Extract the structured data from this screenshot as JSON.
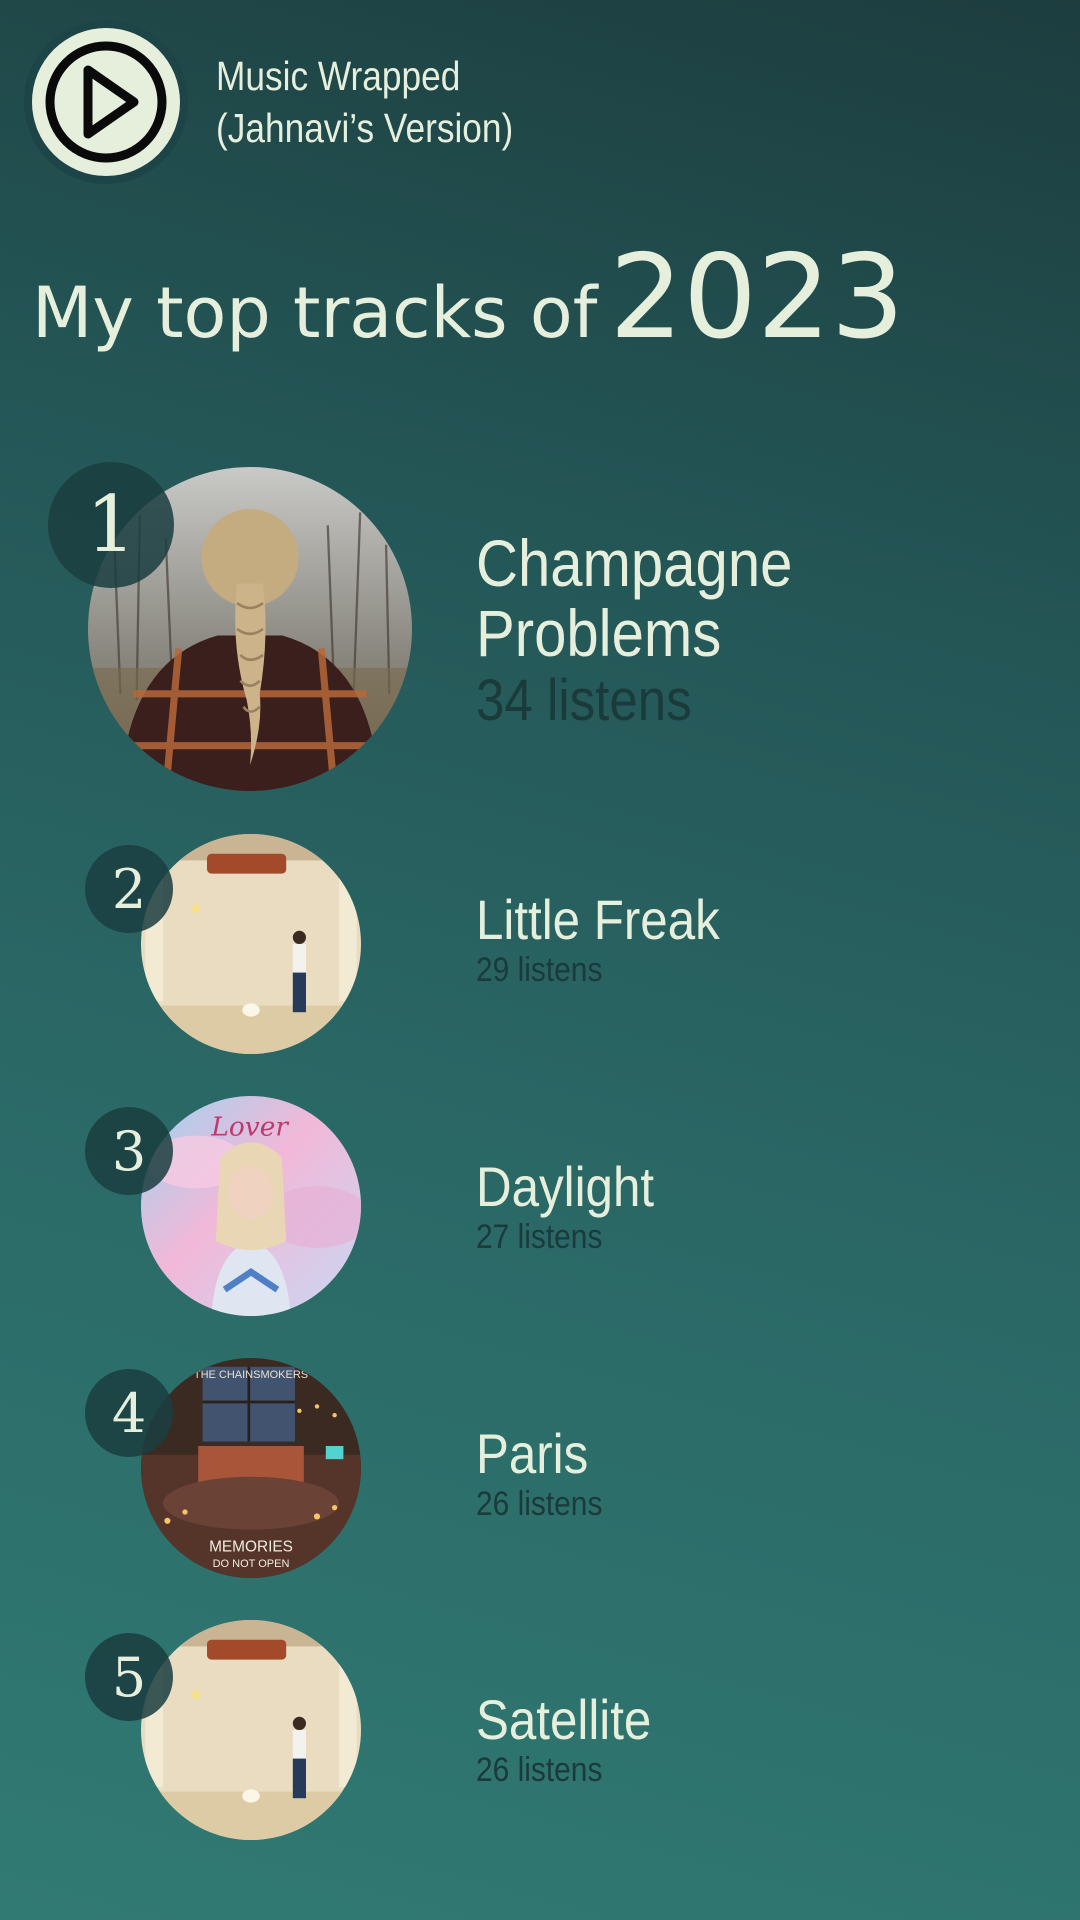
{
  "app": {
    "title_line1": "Music Wrapped",
    "title_line2": "(Jahnavi’s Version)",
    "logo_icon": "play-circle-icon"
  },
  "headline": {
    "lead": "My top tracks of",
    "year": "2023"
  },
  "tracks": [
    {
      "rank": "1",
      "name_line1": "Champagne",
      "name_line2": "Problems",
      "listens": "34 listens",
      "art": "braided-hair-plaid-coat-album-art"
    },
    {
      "rank": "2",
      "name": "Little Freak",
      "listens": "29 listens",
      "art": "empty-room-person-album-art"
    },
    {
      "rank": "3",
      "name": "Daylight",
      "listens": "27 listens",
      "art": "pastel-sky-portrait-album-art"
    },
    {
      "rank": "4",
      "name": "Paris",
      "listens": "26 listens",
      "art": "bedroom-memories-album-art",
      "art_text_top": "THE CHAINSMOKERS",
      "art_text_bottom1": "MEMORIES",
      "art_text_bottom2": "DO NOT OPEN"
    },
    {
      "rank": "5",
      "name": "Satellite",
      "listens": "26 listens",
      "art": "empty-room-person-album-art"
    }
  ],
  "colors": {
    "text_light": "#e6efdc",
    "text_dark": "#1a3a3c",
    "badge": "#1b3e40",
    "bg_top": "#1d3d3f",
    "bg_bottom": "#317a73"
  }
}
